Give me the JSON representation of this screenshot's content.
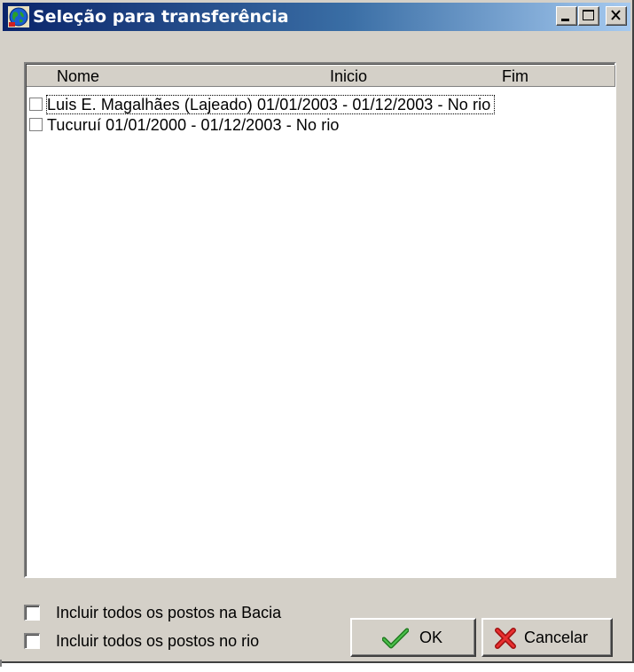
{
  "window": {
    "title": "Seleção para transferência",
    "icon": "globe-icon",
    "controls": {
      "minimize": "minimize-icon",
      "maximize": "maximize-icon",
      "close": "close-icon"
    }
  },
  "list": {
    "columns": [
      "Nome",
      "Inicio",
      "Fim"
    ],
    "rows": [
      {
        "text": "Luis E. Magalhães (Lajeado)  01/01/2003 - 01/12/2003 - No rio",
        "checked": false
      },
      {
        "text": "Tucuruí  01/01/2000 - 01/12/2003 - No rio",
        "checked": false
      }
    ]
  },
  "options": [
    {
      "label": "Incluir todos os postos na Bacia",
      "checked": false
    },
    {
      "label": "Incluir todos os postos no rio",
      "checked": false
    }
  ],
  "buttons": {
    "ok": {
      "label": "OK",
      "icon": "checkmark-icon",
      "icon_color": "#2e8b2e"
    },
    "cancel": {
      "label": "Cancelar",
      "icon": "x-cross-icon",
      "icon_color": "#d42020"
    }
  },
  "colors": {
    "titlebar_start": "#0a246a",
    "titlebar_end": "#a6caf0",
    "face": "#d4d0c8"
  }
}
